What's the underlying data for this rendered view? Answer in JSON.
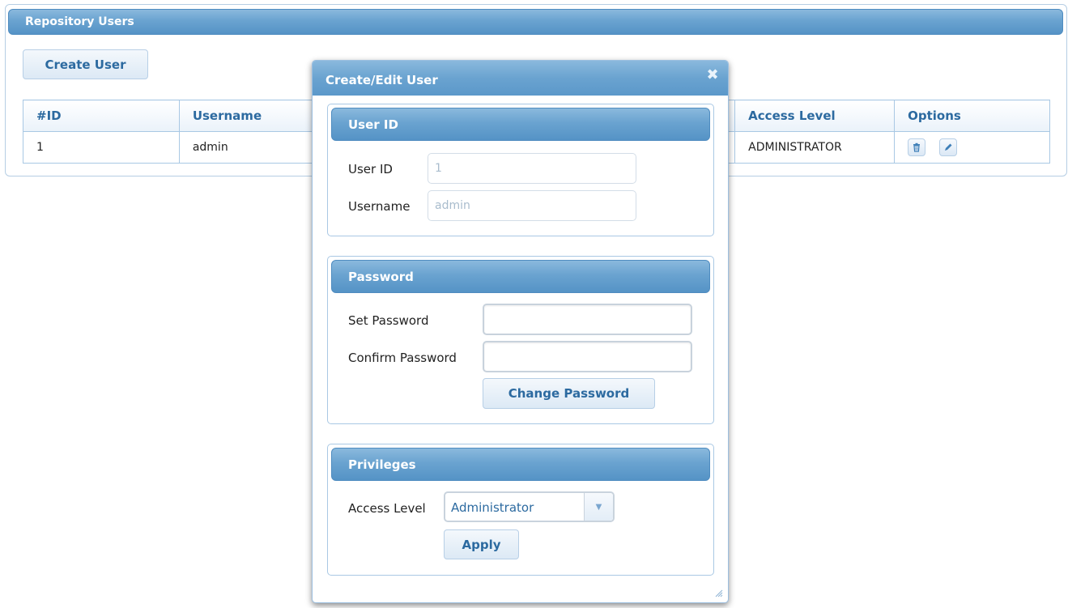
{
  "panel": {
    "title": "Repository Users",
    "create_button": "Create User",
    "table": {
      "headers": [
        "#ID",
        "Username",
        "Access Level",
        "Options"
      ],
      "rows": [
        {
          "id": "1",
          "username": "admin",
          "access_level": "ADMINISTRATOR"
        }
      ],
      "row_actions": [
        "trash-icon",
        "pencil-icon"
      ]
    }
  },
  "dialog": {
    "title": "Create/Edit User",
    "close_glyph": "✖",
    "user_id_section": {
      "title": "User ID",
      "user_id_label": "User ID",
      "user_id_value": "1",
      "username_label": "Username",
      "username_value": "admin"
    },
    "password_section": {
      "title": "Password",
      "set_label": "Set Password",
      "set_value": "",
      "confirm_label": "Confirm Password",
      "confirm_value": "",
      "change_button": "Change Password"
    },
    "privileges_section": {
      "title": "Privileges",
      "access_label": "Access Level",
      "access_value": "Administrator",
      "apply_button": "Apply"
    }
  },
  "colors": {
    "header_blue": "#5f9acb",
    "link_blue": "#2c6aa0",
    "border_blue": "#a9c8e4"
  }
}
